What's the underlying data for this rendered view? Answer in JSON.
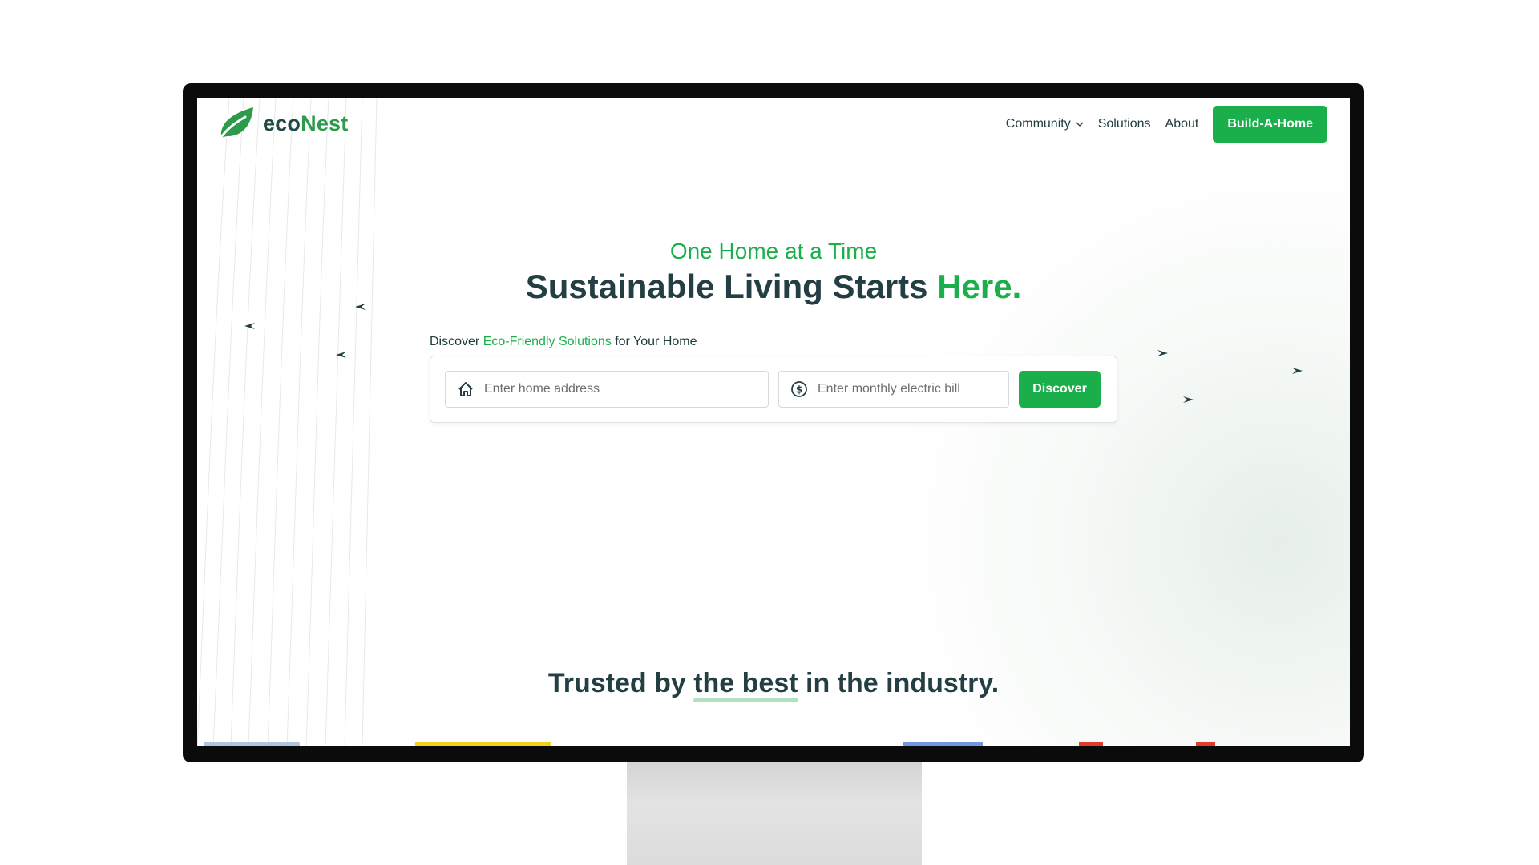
{
  "brand": {
    "prefix": "eco",
    "suffix": "Nest"
  },
  "nav": {
    "community": "Community",
    "solutions": "Solutions",
    "about": "About",
    "cta": "Build-A-Home"
  },
  "hero": {
    "tagline": "One Home at a Time",
    "headline_main": "Sustainable Living Starts ",
    "headline_accent": "Here."
  },
  "discover": {
    "label_start": "Discover ",
    "label_accent": "Eco-Friendly Solutions",
    "label_end": " for Your Home",
    "address_placeholder": "Enter home address",
    "bill_placeholder": "Enter monthly electric bill",
    "button": "Discover"
  },
  "trusted": {
    "part1": "Trusted by ",
    "highlight": "the best",
    "part2": " in the industry."
  },
  "colors": {
    "accent": "#1aaf4b",
    "dark": "#233f44"
  },
  "icons": [
    "leaf-icon",
    "chevron-down-icon",
    "home-icon",
    "dollar-icon",
    "bird-icon"
  ]
}
